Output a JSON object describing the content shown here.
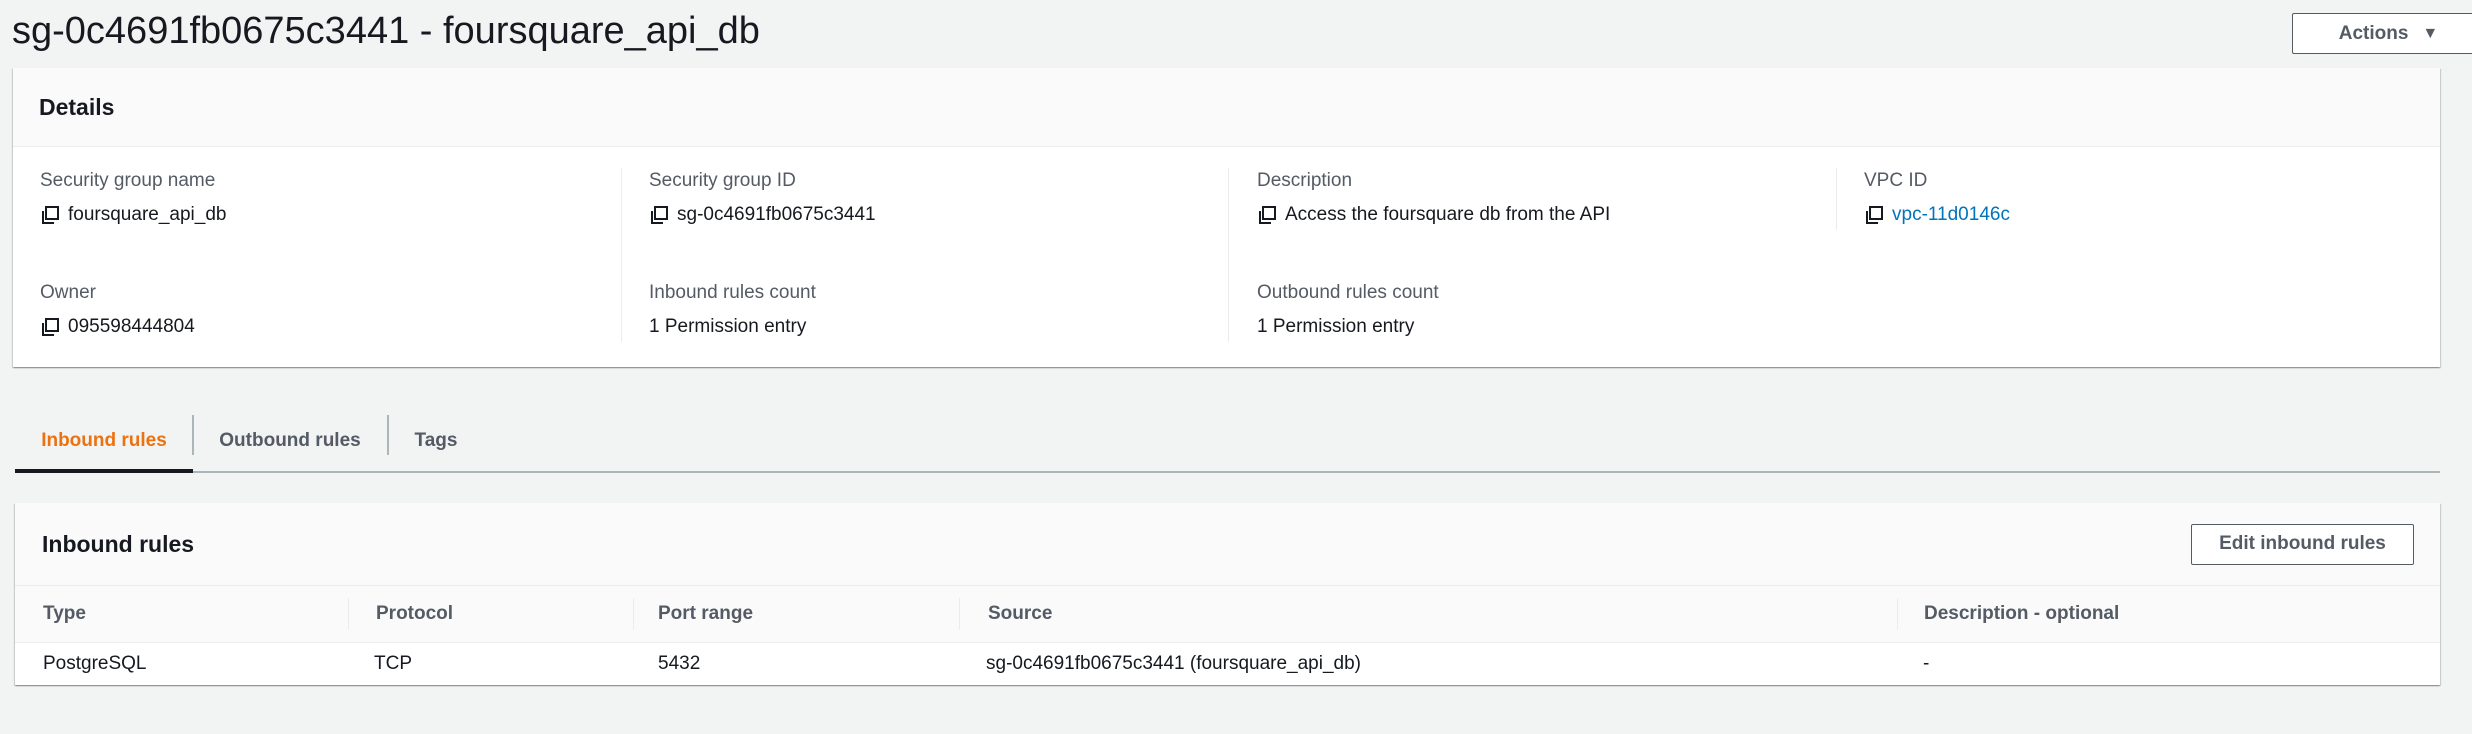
{
  "page": {
    "title": "sg-0c4691fb0675c3441 - foursquare_api_db",
    "actions_label": "Actions"
  },
  "details": {
    "title": "Details",
    "fields": {
      "security_group_name": {
        "label": "Security group name",
        "value": "foursquare_api_db"
      },
      "security_group_id": {
        "label": "Security group ID",
        "value": "sg-0c4691fb0675c3441"
      },
      "description": {
        "label": "Description",
        "value": "Access the foursquare db from the API"
      },
      "vpc_id": {
        "label": "VPC ID",
        "value": "vpc-11d0146c"
      },
      "owner": {
        "label": "Owner",
        "value": "095598444804"
      },
      "inbound_count": {
        "label": "Inbound rules count",
        "value": "1 Permission entry"
      },
      "outbound_count": {
        "label": "Outbound rules count",
        "value": "1 Permission entry"
      }
    }
  },
  "tabs": [
    {
      "label": "Inbound rules",
      "active": true
    },
    {
      "label": "Outbound rules",
      "active": false
    },
    {
      "label": "Tags",
      "active": false
    }
  ],
  "inbound_rules": {
    "title": "Inbound rules",
    "edit_button_label": "Edit inbound rules",
    "columns": [
      "Type",
      "Protocol",
      "Port range",
      "Source",
      "Description - optional"
    ],
    "rows": [
      [
        "PostgreSQL",
        "TCP",
        "5432",
        "sg-0c4691fb0675c3441 (foursquare_api_db)",
        "-"
      ]
    ]
  },
  "colors": {
    "accent_orange": "#ec7211",
    "link_blue": "#0073bb",
    "text_dark": "#16191f",
    "text_secondary": "#545b64"
  },
  "icons": {
    "copy": "copy-icon",
    "caret": "caret-down-icon"
  }
}
